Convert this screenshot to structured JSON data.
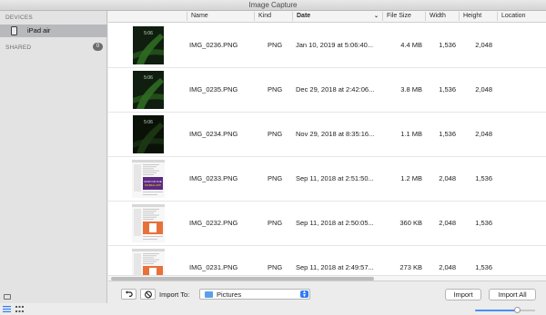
{
  "window": {
    "title": "Image Capture"
  },
  "sidebar": {
    "devices_header": "DEVICES",
    "device": {
      "label": "iPad air",
      "icon": "ipad-icon"
    },
    "shared_header": "SHARED",
    "shared_count": "0"
  },
  "table": {
    "columns": [
      "Name",
      "Kind",
      "Date",
      "File Size",
      "Width",
      "Height",
      "Location"
    ],
    "sorted_column": "Date",
    "rows": [
      {
        "name": "IMG_0236.PNG",
        "kind": "PNG",
        "date": "Jan 10, 2019 at 5:06:40...",
        "size": "4.4 MB",
        "width": "1,536",
        "height": "2,048",
        "thumb": "lockscreen"
      },
      {
        "name": "IMG_0235.PNG",
        "kind": "PNG",
        "date": "Dec 29, 2018 at 2:42:06...",
        "size": "3.8 MB",
        "width": "1,536",
        "height": "2,048",
        "thumb": "lockscreen"
      },
      {
        "name": "IMG_0234.PNG",
        "kind": "PNG",
        "date": "Nov 29, 2018 at 8:35:16...",
        "size": "1.1 MB",
        "width": "1,536",
        "height": "2,048",
        "thumb": "lockscreen-dark"
      },
      {
        "name": "IMG_0233.PNG",
        "kind": "PNG",
        "date": "Sep 11, 2018 at 2:51:50...",
        "size": "1.2 MB",
        "width": "2,048",
        "height": "1,536",
        "thumb": "webpage-purple"
      },
      {
        "name": "IMG_0232.PNG",
        "kind": "PNG",
        "date": "Sep 11, 2018 at 2:50:05...",
        "size": "360 KB",
        "width": "2,048",
        "height": "1,536",
        "thumb": "webpage-orange"
      },
      {
        "name": "IMG_0231.PNG",
        "kind": "PNG",
        "date": "Sep 11, 2018 at 2:49:57...",
        "size": "273 KB",
        "width": "2,048",
        "height": "1,536",
        "thumb": "webpage-orange"
      }
    ],
    "thumb_text": "NOW ON THE MOBILE APP"
  },
  "bottom": {
    "import_to_label": "Import To:",
    "destination": "Pictures",
    "import_label": "Import",
    "import_all_label": "Import All",
    "zoom_level": 0.7
  },
  "colors": {
    "accent": "#2e7cf6",
    "sidebar_selection": "#b7b9bd",
    "thumb_purple": "#5a2a84",
    "thumb_orange": "#e8703a"
  }
}
